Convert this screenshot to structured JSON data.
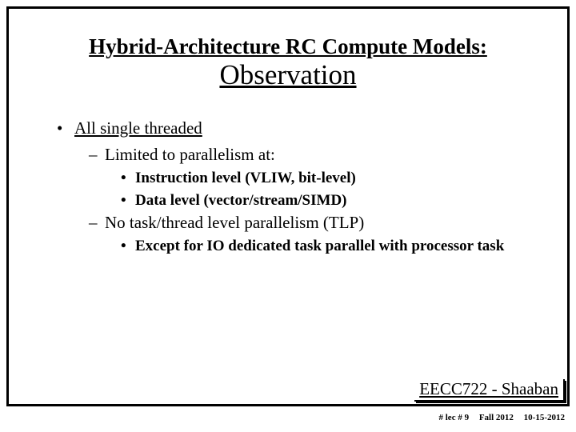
{
  "title": {
    "line1": "Hybrid-Architecture RC Compute Models:",
    "line2": "Observation"
  },
  "bullets": {
    "l1": "All single threaded",
    "l2a": "Limited to parallelism at:",
    "l3a": "Instruction level (VLIW, bit-level)",
    "l3b": "Data level (vector/stream/SIMD)",
    "l2b": "No task/thread level parallelism (TLP)",
    "l3c": "Except for IO dedicated task parallel with processor task"
  },
  "course_tag": "EECC722 - Shaaban",
  "footer": {
    "lec": "#  lec # 9",
    "term": "Fall 2012",
    "date": "10-15-2012"
  }
}
